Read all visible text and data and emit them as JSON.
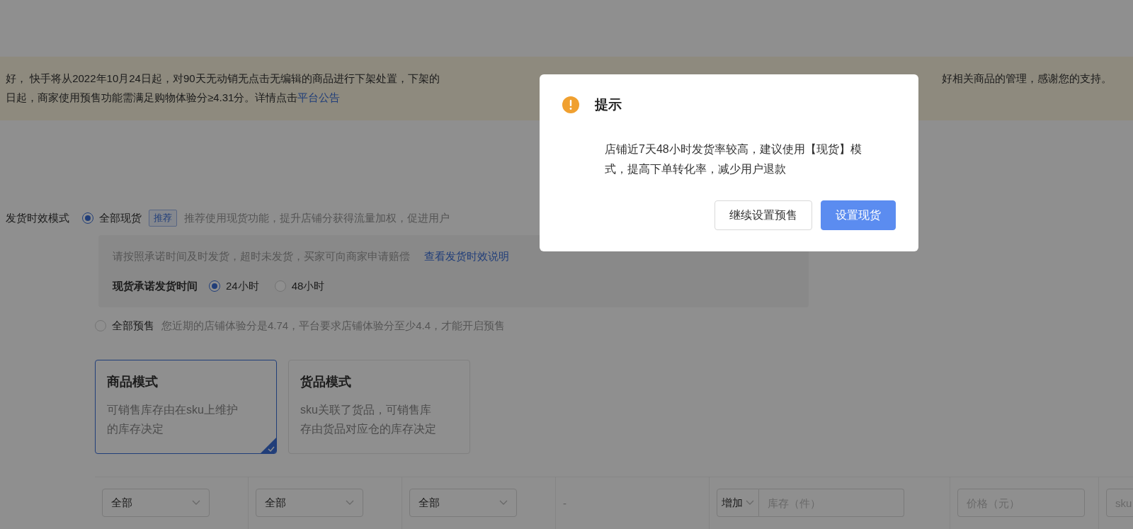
{
  "notice": {
    "line_1_left": "好， 快手将从2022年10月24日起，对90天无动销无点击无编辑的商品进行下架处置，下架的",
    "line_1_right": "好相关商品的管理，感谢您的支持。",
    "line_2": "日起，商家使用预售功能需满足购物体验分≥4.31分。详情点击",
    "line_2_link": "平台公告"
  },
  "shipping_mode": {
    "label": "发货时效模式",
    "options": [
      {
        "label": "全部现货",
        "selected": true,
        "tag": "推荐",
        "hint": "推荐使用现货功能，提升店铺分获得流量加权，促进用户"
      },
      {
        "label": "全部预售",
        "selected": false,
        "hint": "您近期的店铺体验分是4.74，平台要求店铺体验分至少4.4，才能开启预售"
      }
    ],
    "spot_panel": {
      "notice": "请按照承诺时间及时发货，超时未发货，买家可向商家申请赔偿",
      "link": "查看发货时效说明",
      "promise_label": "现货承诺发货时间",
      "promise_options": [
        {
          "label": "24小时",
          "selected": true
        },
        {
          "label": "48小时",
          "selected": false
        }
      ]
    }
  },
  "inventory_modes": [
    {
      "title": "商品模式",
      "description": "可销售库存由在sku上维护的库存决定",
      "selected": true
    },
    {
      "title": "货品模式",
      "description": "sku关联了货品，可销售库存由货品对应仓的库存决定",
      "selected": false
    }
  ],
  "filters": [
    {
      "kind": "select",
      "value": "全部"
    },
    {
      "kind": "select",
      "value": "全部"
    },
    {
      "kind": "select",
      "value": "全部"
    },
    {
      "kind": "dash",
      "text": "-"
    },
    {
      "kind": "stock",
      "select": "增加",
      "placeholder": "库存（件）"
    },
    {
      "kind": "input",
      "placeholder": "价格（元）"
    },
    {
      "kind": "input",
      "placeholder": "sku"
    }
  ],
  "dialog": {
    "title": "提示",
    "message": "店铺近7天48小时发货率较高，建议使用【现货】模式，提高下单转化率，减少用户退款",
    "buttons": [
      {
        "label": "继续设置预售",
        "primary": false
      },
      {
        "label": "设置现货",
        "primary": true
      }
    ]
  }
}
